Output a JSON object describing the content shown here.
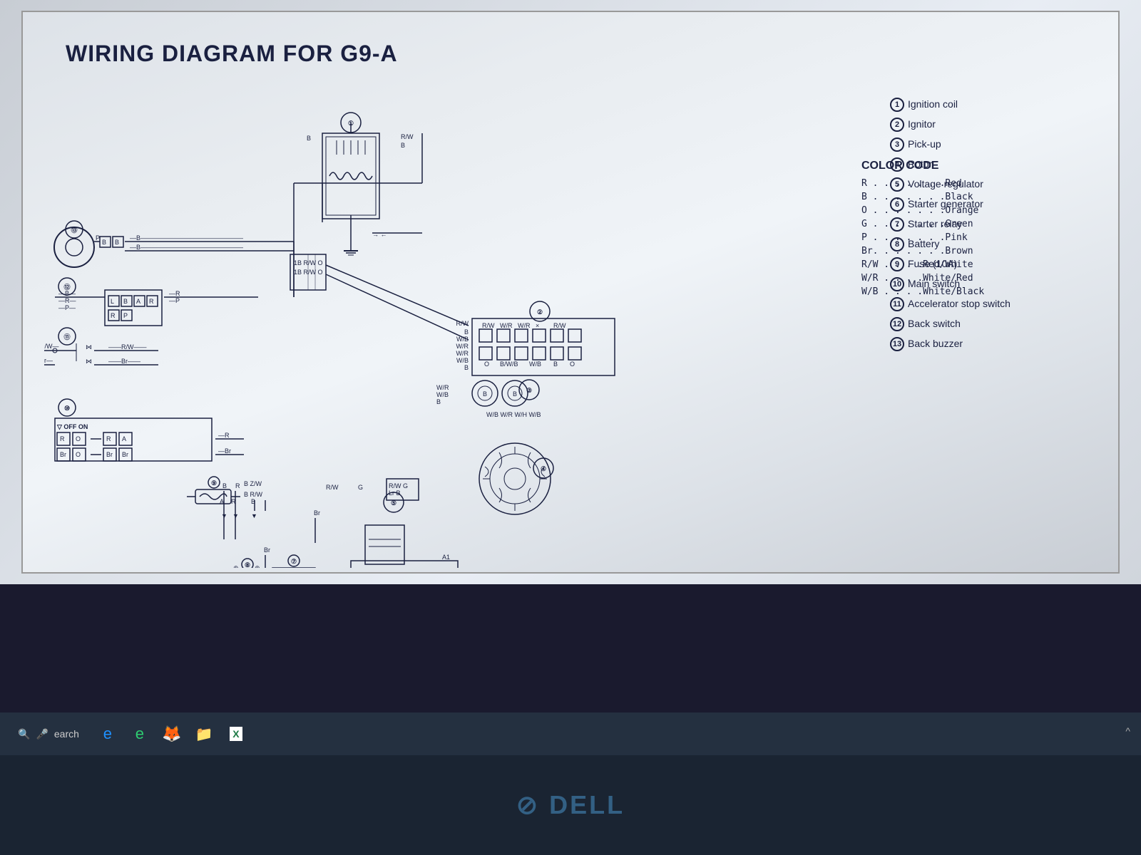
{
  "diagram": {
    "title": "WIRING DIAGRAM FOR G9-A",
    "legend": [
      {
        "num": "1",
        "text": "Ignition coil"
      },
      {
        "num": "2",
        "text": "Ignitor"
      },
      {
        "num": "3",
        "text": "Pick-up"
      },
      {
        "num": "4",
        "text": "Rotor"
      },
      {
        "num": "5",
        "text": "Voltage regulator"
      },
      {
        "num": "6",
        "text": "Starter generator"
      },
      {
        "num": "7",
        "text": "Starter relay"
      },
      {
        "num": "8",
        "text": "Battery"
      },
      {
        "num": "9",
        "text": "Fuse (10A)"
      },
      {
        "num": "10",
        "text": "Main switch"
      },
      {
        "num": "11",
        "text": "Accelerator stop switch"
      },
      {
        "num": "12",
        "text": "Back switch"
      },
      {
        "num": "13",
        "text": "Back buzzer"
      }
    ],
    "color_code": {
      "title": "COLOR CODE",
      "items": [
        {
          "code": "R . . . . . . .Red"
        },
        {
          "code": "B . . . . . . .Black"
        },
        {
          "code": "O . . . . . . .Orange"
        },
        {
          "code": "G . . . . . . .Green"
        },
        {
          "code": "P . . . . . . .Pink"
        },
        {
          "code": "Br. . . . . . .Brown"
        },
        {
          "code": "R/W . . . .Red/White"
        },
        {
          "code": "W/R . . . .White/Red"
        },
        {
          "code": "W/B . . . .White/Black"
        }
      ]
    }
  },
  "taskbar": {
    "search_placeholder": "earch",
    "icons": [
      "e",
      "e",
      "🦊",
      "📁",
      "X"
    ],
    "chevron": "^"
  }
}
